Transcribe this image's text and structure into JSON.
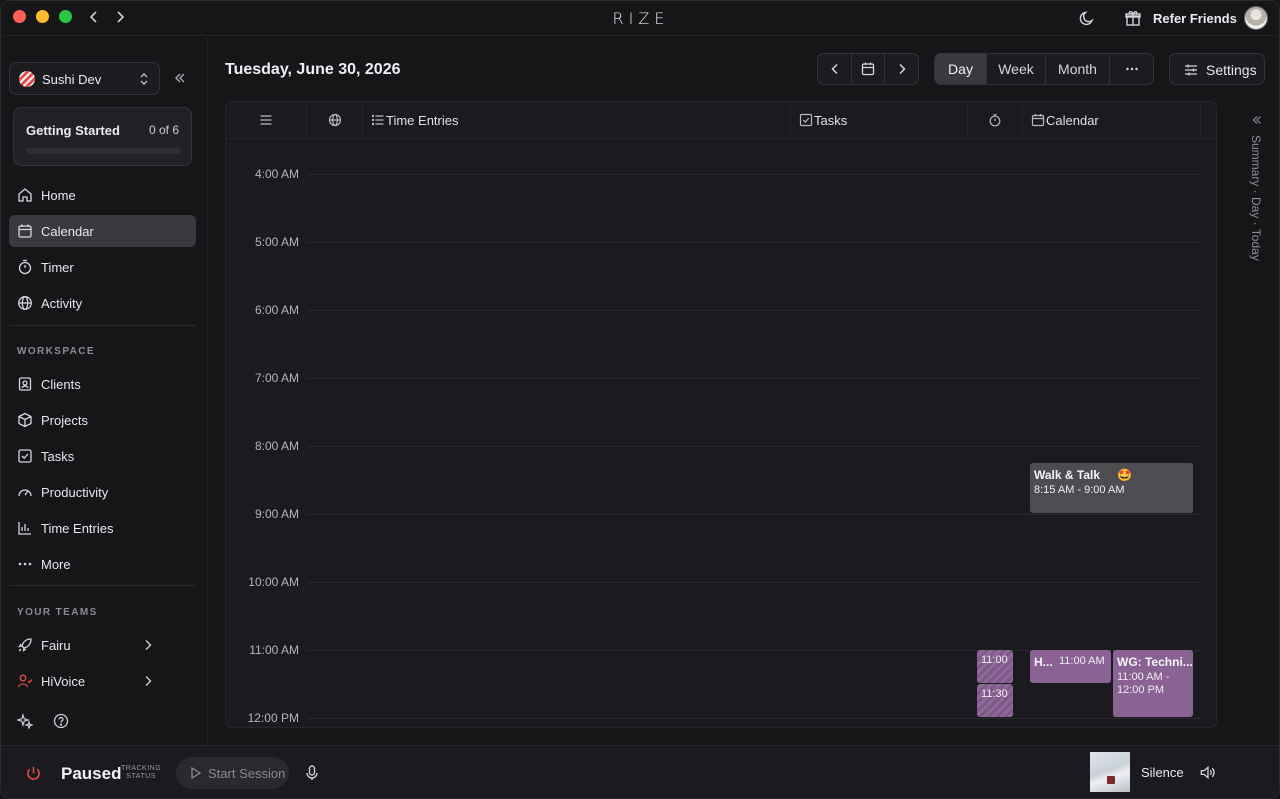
{
  "app": {
    "logo": "RIZE"
  },
  "titlebar": {
    "refer_label": "Refer Friends"
  },
  "workspace": {
    "name": "Sushi Dev"
  },
  "getting_started": {
    "title": "Getting Started",
    "count": "0 of 6",
    "progress": 0
  },
  "nav": {
    "items": [
      {
        "label": "Home",
        "icon": "home-icon"
      },
      {
        "label": "Calendar",
        "icon": "calendar-icon",
        "active": true
      },
      {
        "label": "Timer",
        "icon": "timer-icon"
      },
      {
        "label": "Activity",
        "icon": "globe-icon"
      }
    ]
  },
  "workspace_section": {
    "label": "WORKSPACE",
    "items": [
      {
        "label": "Clients",
        "icon": "contact-icon"
      },
      {
        "label": "Projects",
        "icon": "box-icon"
      },
      {
        "label": "Tasks",
        "icon": "checkbox-icon"
      },
      {
        "label": "Productivity",
        "icon": "gauge-icon"
      },
      {
        "label": "Time Entries",
        "icon": "bar-chart-icon"
      },
      {
        "label": "More",
        "icon": "ellipsis-icon"
      }
    ]
  },
  "teams": {
    "label": "YOUR TEAMS",
    "items": [
      {
        "label": "Fairu",
        "icon": "rocket-icon"
      },
      {
        "label": "HiVoice",
        "icon": "user-check-icon",
        "color": "#e24c4c"
      }
    ]
  },
  "header": {
    "date": "Tuesday, June 30, 2026",
    "views": [
      "Day",
      "Week",
      "Month"
    ],
    "selected_view": "Day",
    "settings_label": "Settings"
  },
  "columns": {
    "time_entries": "Time Entries",
    "tasks": "Tasks",
    "calendar": "Calendar"
  },
  "hours": [
    "4:00 AM",
    "5:00 AM",
    "6:00 AM",
    "7:00 AM",
    "8:00 AM",
    "9:00 AM",
    "10:00 AM",
    "11:00 AM",
    "12:00 PM"
  ],
  "events": {
    "walk": {
      "title": "Walk & Talk",
      "emoji": "🤩",
      "time": "8:15 AM - 9:00 AM"
    },
    "h": {
      "title": "H...",
      "time": "11:00 AM"
    },
    "wg": {
      "title": "WG: Techni...",
      "time_line1": "11:00 AM -",
      "time_line2": "12:00 PM"
    },
    "timer_a": "11:00",
    "timer_b": "11:30"
  },
  "summary_rail": {
    "label": "Summary · Day · Today"
  },
  "bottombar": {
    "status": "Paused",
    "tracking_line1": "TRACKING",
    "tracking_line2": "STATUS",
    "start_session": "Start Session",
    "music_title": "Silence"
  },
  "colors": {
    "accent": "#8a86f3",
    "event_purple": "#8a6394",
    "event_gray": "#4d4c51",
    "power_red": "#e24c4c"
  }
}
